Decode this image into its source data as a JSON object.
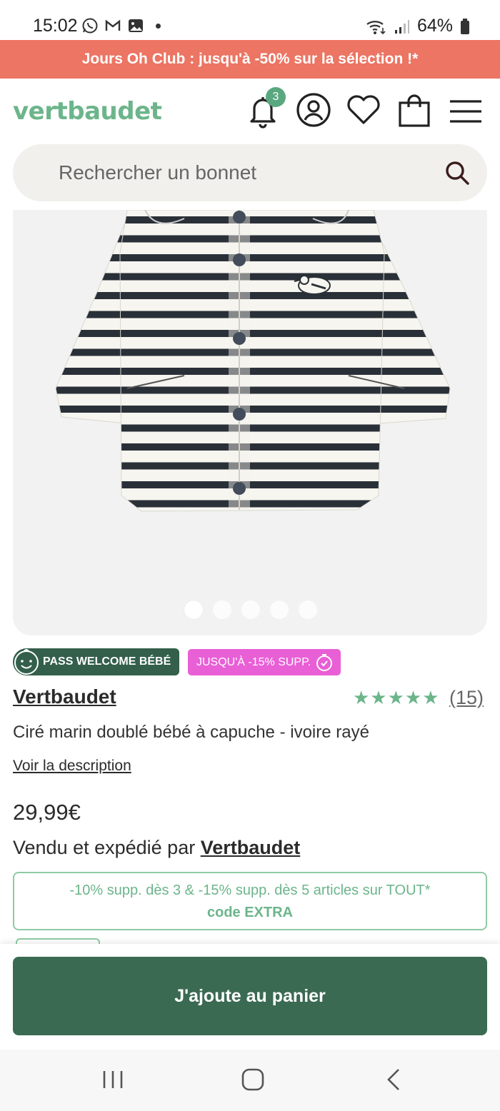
{
  "status_bar": {
    "time": "15:02",
    "battery": "64%",
    "notification_icons": [
      "whatsapp-icon",
      "gmail-icon",
      "gallery-icon"
    ]
  },
  "promo_banner": {
    "text": "Jours Oh Club : jusqu'à -50% sur la sélection !*"
  },
  "header": {
    "logo": "vertbaudet",
    "notification_count": "3",
    "icons": [
      "bell-icon",
      "account-icon",
      "heart-icon",
      "bag-icon",
      "menu-icon"
    ]
  },
  "search": {
    "placeholder": "Rechercher un bonnet"
  },
  "gallery": {
    "image_count": 5,
    "active_index": 0
  },
  "badges": {
    "welcome": "PASS WELCOME BÉBÉ",
    "promo": "JUSQU'À -15% SUPP."
  },
  "product": {
    "brand": "Vertbaudet",
    "rating_stars": "★★★★★",
    "rating": 5,
    "review_count": "(15)",
    "name": "Ciré marin doublé bébé à capuche - ivoire rayé",
    "description_link": "Voir la description",
    "price": "29,99€",
    "seller_prefix": "Vendu et expédié par ",
    "seller_name": "Vertbaudet"
  },
  "promo_box": {
    "line1": "-10% supp. dès 3 & -15% supp. dès 5 articles sur TOUT*",
    "line2": "code EXTRA"
  },
  "cta": {
    "add_to_cart": "J'ajoute au panier"
  },
  "colors": {
    "brand_green": "#6cb58b",
    "dark_green": "#3b6a52",
    "promo_banner": "#ec7563",
    "promo_pink": "#e85fd6"
  }
}
